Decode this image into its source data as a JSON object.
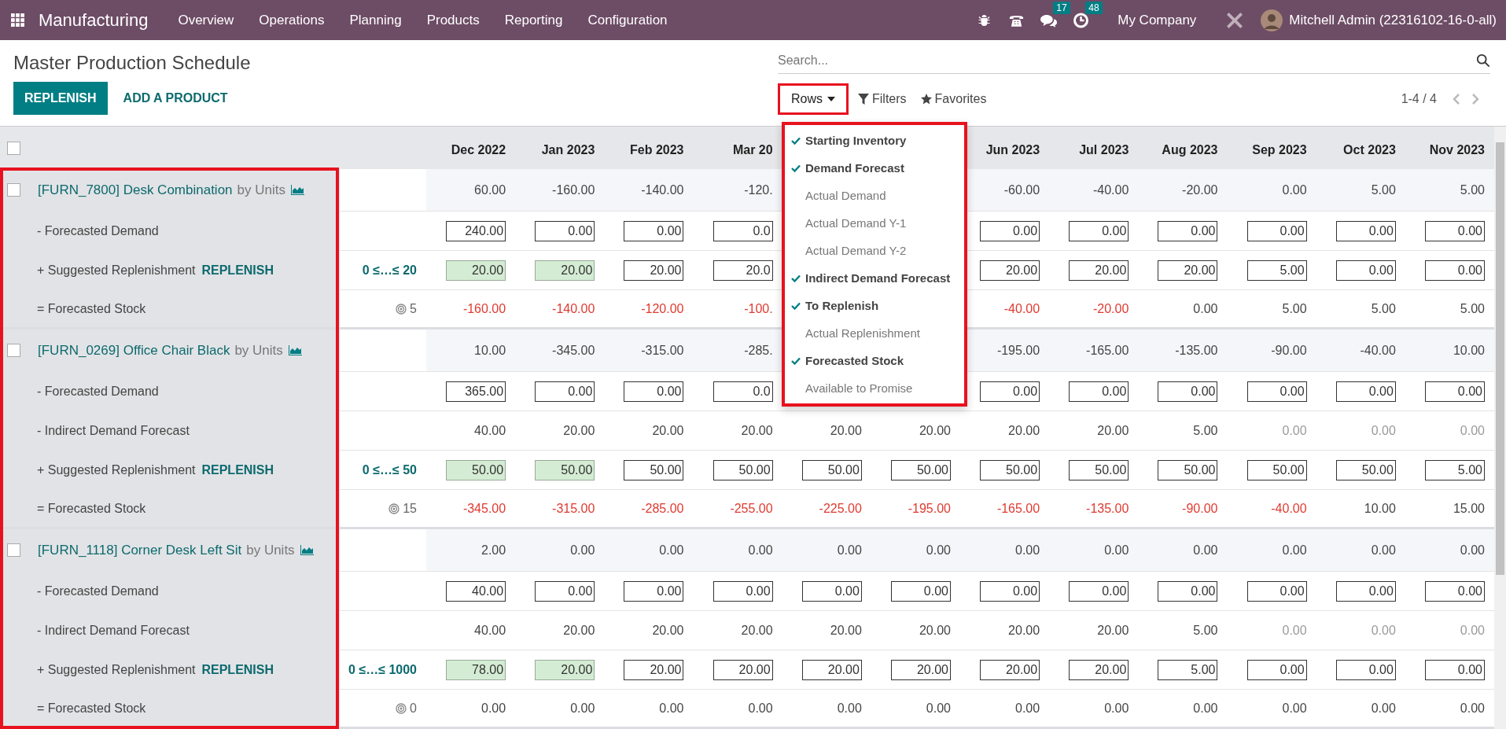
{
  "navbar": {
    "app_name": "Manufacturing",
    "menu": [
      "Overview",
      "Operations",
      "Planning",
      "Products",
      "Reporting",
      "Configuration"
    ],
    "messages_count": "17",
    "activities_count": "48",
    "company": "My Company",
    "user": "Mitchell Admin (22316102-16-0-all)"
  },
  "page": {
    "title": "Master Production Schedule",
    "buttons": [
      {
        "label": "REPLENISH",
        "kind": "primary"
      },
      {
        "label": "ADD A PRODUCT",
        "kind": "link"
      }
    ]
  },
  "search": {
    "placeholder": "Search..."
  },
  "toolbar": {
    "rows": "Rows",
    "filters": "Filters",
    "favorites": "Favorites",
    "pager": "1-4 / 4"
  },
  "rows_menu": {
    "items": [
      {
        "label": "Starting Inventory",
        "checked": true
      },
      {
        "label": "Demand Forecast",
        "checked": true
      },
      {
        "label": "Actual Demand",
        "checked": false
      },
      {
        "label": "Actual Demand Y-1",
        "checked": false
      },
      {
        "label": "Actual Demand Y-2",
        "checked": false
      },
      {
        "label": "Indirect Demand Forecast",
        "checked": true
      },
      {
        "label": "To Replenish",
        "checked": true
      },
      {
        "label": "Actual Replenishment",
        "checked": false
      },
      {
        "label": "Forecasted Stock",
        "checked": true
      },
      {
        "label": "Available to Promise",
        "checked": false
      }
    ]
  },
  "table": {
    "select_all_checked": false,
    "columns": [
      "Dec 2022",
      "Jan 2023",
      "Feb 2023",
      "Mar 20",
      null,
      null,
      "Jun 2023",
      "Jul 2023",
      "Aug 2023",
      "Sep 2023",
      "Oct 2023",
      "Nov 2023"
    ],
    "rows": [
      {
        "kind": "product",
        "checked": false,
        "product": "[FURN_7800] Desk Combination",
        "unit": "by Units",
        "cells": [
          {
            "text": "60.00",
            "kind": "plain"
          },
          {
            "text": "-160.00",
            "kind": "plain"
          },
          {
            "text": "-140.00",
            "kind": "plain"
          },
          {
            "text": "-120.",
            "kind": "plain"
          },
          null,
          null,
          {
            "text": "-60.00",
            "kind": "plain"
          },
          {
            "text": "-40.00",
            "kind": "plain"
          },
          {
            "text": "-20.00",
            "kind": "plain"
          },
          {
            "text": "0.00",
            "kind": "plain"
          },
          {
            "text": "5.00",
            "kind": "plain"
          },
          {
            "text": "5.00",
            "kind": "plain"
          }
        ]
      },
      {
        "kind": "demand",
        "label": "- Forecasted Demand",
        "cells": [
          {
            "text": "240.00",
            "kind": "plain"
          },
          {
            "text": "0.00",
            "kind": "plain"
          },
          {
            "text": "0.00",
            "kind": "plain"
          },
          {
            "text": "0.0",
            "kind": "plain"
          },
          null,
          null,
          {
            "text": "0.00",
            "kind": "plain"
          },
          {
            "text": "0.00",
            "kind": "plain"
          },
          {
            "text": "0.00",
            "kind": "plain"
          },
          {
            "text": "0.00",
            "kind": "plain"
          },
          {
            "text": "0.00",
            "kind": "plain"
          },
          {
            "text": "0.00",
            "kind": "plain"
          }
        ]
      },
      {
        "kind": "replenish",
        "label": "+ Suggested Replenishment",
        "action": "REPLENISH",
        "range": "0 ≤…≤ 20",
        "cells": [
          {
            "text": "20.00",
            "kind": "suggested"
          },
          {
            "text": "20.00",
            "kind": "suggested"
          },
          {
            "text": "20.00",
            "kind": "plain"
          },
          {
            "text": "20.0",
            "kind": "plain"
          },
          null,
          null,
          {
            "text": "20.00",
            "kind": "plain"
          },
          {
            "text": "20.00",
            "kind": "plain"
          },
          {
            "text": "20.00",
            "kind": "plain"
          },
          {
            "text": "5.00",
            "kind": "plain"
          },
          {
            "text": "0.00",
            "kind": "plain"
          },
          {
            "text": "0.00",
            "kind": "plain"
          }
        ]
      },
      {
        "kind": "stock",
        "label": "= Forecasted Stock",
        "safety": "5",
        "cells": [
          {
            "text": "-160.00",
            "kind": "negative"
          },
          {
            "text": "-140.00",
            "kind": "negative"
          },
          {
            "text": "-120.00",
            "kind": "negative"
          },
          {
            "text": "-100.",
            "kind": "negative"
          },
          null,
          null,
          {
            "text": "-40.00",
            "kind": "negative"
          },
          {
            "text": "-20.00",
            "kind": "negative"
          },
          {
            "text": "0.00",
            "kind": "plain"
          },
          {
            "text": "5.00",
            "kind": "plain"
          },
          {
            "text": "5.00",
            "kind": "plain"
          },
          {
            "text": "5.00",
            "kind": "plain"
          }
        ]
      },
      {
        "kind": "product",
        "checked": false,
        "product": "[FURN_0269] Office Chair Black",
        "unit": "by Units",
        "cells": [
          {
            "text": "10.00",
            "kind": "plain"
          },
          {
            "text": "-345.00",
            "kind": "plain"
          },
          {
            "text": "-315.00",
            "kind": "plain"
          },
          {
            "text": "-285.",
            "kind": "plain"
          },
          null,
          null,
          {
            "text": "-195.00",
            "kind": "plain"
          },
          {
            "text": "-165.00",
            "kind": "plain"
          },
          {
            "text": "-135.00",
            "kind": "plain"
          },
          {
            "text": "-90.00",
            "kind": "plain"
          },
          {
            "text": "-40.00",
            "kind": "plain"
          },
          {
            "text": "10.00",
            "kind": "plain"
          }
        ]
      },
      {
        "kind": "demand",
        "label": "- Forecasted Demand",
        "cells": [
          {
            "text": "365.00",
            "kind": "plain"
          },
          {
            "text": "0.00",
            "kind": "plain"
          },
          {
            "text": "0.00",
            "kind": "plain"
          },
          {
            "text": "0.0",
            "kind": "plain"
          },
          null,
          null,
          {
            "text": "0.00",
            "kind": "plain"
          },
          {
            "text": "0.00",
            "kind": "plain"
          },
          {
            "text": "0.00",
            "kind": "plain"
          },
          {
            "text": "0.00",
            "kind": "plain"
          },
          {
            "text": "0.00",
            "kind": "plain"
          },
          {
            "text": "0.00",
            "kind": "plain"
          }
        ]
      },
      {
        "kind": "indirect",
        "label": "- Indirect Demand Forecast",
        "cells": [
          {
            "text": "40.00",
            "kind": "plain"
          },
          {
            "text": "20.00",
            "kind": "plain"
          },
          {
            "text": "20.00",
            "kind": "plain"
          },
          {
            "text": "20.00",
            "kind": "plain"
          },
          {
            "text": "20.00",
            "kind": "plain"
          },
          {
            "text": "20.00",
            "kind": "plain"
          },
          {
            "text": "20.00",
            "kind": "plain"
          },
          {
            "text": "20.00",
            "kind": "plain"
          },
          {
            "text": "5.00",
            "kind": "plain"
          },
          {
            "text": "0.00",
            "kind": "muted"
          },
          {
            "text": "0.00",
            "kind": "muted"
          },
          {
            "text": "0.00",
            "kind": "muted"
          }
        ]
      },
      {
        "kind": "replenish",
        "label": "+ Suggested Replenishment",
        "action": "REPLENISH",
        "range": "0 ≤…≤ 50",
        "cells": [
          {
            "text": "50.00",
            "kind": "suggested"
          },
          {
            "text": "50.00",
            "kind": "suggested"
          },
          {
            "text": "50.00",
            "kind": "plain"
          },
          {
            "text": "50.00",
            "kind": "plain"
          },
          {
            "text": "50.00",
            "kind": "plain"
          },
          {
            "text": "50.00",
            "kind": "plain"
          },
          {
            "text": "50.00",
            "kind": "plain"
          },
          {
            "text": "50.00",
            "kind": "plain"
          },
          {
            "text": "50.00",
            "kind": "plain"
          },
          {
            "text": "50.00",
            "kind": "plain"
          },
          {
            "text": "50.00",
            "kind": "plain"
          },
          {
            "text": "5.00",
            "kind": "plain"
          }
        ]
      },
      {
        "kind": "stock",
        "label": "= Forecasted Stock",
        "safety": "15",
        "cells": [
          {
            "text": "-345.00",
            "kind": "negative"
          },
          {
            "text": "-315.00",
            "kind": "negative"
          },
          {
            "text": "-285.00",
            "kind": "negative"
          },
          {
            "text": "-255.00",
            "kind": "negative"
          },
          {
            "text": "-225.00",
            "kind": "negative"
          },
          {
            "text": "-195.00",
            "kind": "negative"
          },
          {
            "text": "-165.00",
            "kind": "negative"
          },
          {
            "text": "-135.00",
            "kind": "negative"
          },
          {
            "text": "-90.00",
            "kind": "negative"
          },
          {
            "text": "-40.00",
            "kind": "negative"
          },
          {
            "text": "10.00",
            "kind": "plain"
          },
          {
            "text": "15.00",
            "kind": "plain"
          }
        ]
      },
      {
        "kind": "product",
        "checked": false,
        "product": "[FURN_1118] Corner Desk Left Sit",
        "unit": "by Units",
        "cells": [
          {
            "text": "2.00",
            "kind": "plain"
          },
          {
            "text": "0.00",
            "kind": "plain"
          },
          {
            "text": "0.00",
            "kind": "plain"
          },
          {
            "text": "0.00",
            "kind": "plain"
          },
          {
            "text": "0.00",
            "kind": "plain"
          },
          {
            "text": "0.00",
            "kind": "plain"
          },
          {
            "text": "0.00",
            "kind": "plain"
          },
          {
            "text": "0.00",
            "kind": "plain"
          },
          {
            "text": "0.00",
            "kind": "plain"
          },
          {
            "text": "0.00",
            "kind": "plain"
          },
          {
            "text": "0.00",
            "kind": "plain"
          },
          {
            "text": "0.00",
            "kind": "plain"
          }
        ]
      },
      {
        "kind": "demand",
        "label": "- Forecasted Demand",
        "cells": [
          {
            "text": "40.00",
            "kind": "plain"
          },
          {
            "text": "0.00",
            "kind": "plain"
          },
          {
            "text": "0.00",
            "kind": "plain"
          },
          {
            "text": "0.00",
            "kind": "plain"
          },
          {
            "text": "0.00",
            "kind": "plain"
          },
          {
            "text": "0.00",
            "kind": "plain"
          },
          {
            "text": "0.00",
            "kind": "plain"
          },
          {
            "text": "0.00",
            "kind": "plain"
          },
          {
            "text": "0.00",
            "kind": "plain"
          },
          {
            "text": "0.00",
            "kind": "plain"
          },
          {
            "text": "0.00",
            "kind": "plain"
          },
          {
            "text": "0.00",
            "kind": "plain"
          }
        ]
      },
      {
        "kind": "indirect",
        "label": "- Indirect Demand Forecast",
        "cells": [
          {
            "text": "40.00",
            "kind": "plain"
          },
          {
            "text": "20.00",
            "kind": "plain"
          },
          {
            "text": "20.00",
            "kind": "plain"
          },
          {
            "text": "20.00",
            "kind": "plain"
          },
          {
            "text": "20.00",
            "kind": "plain"
          },
          {
            "text": "20.00",
            "kind": "plain"
          },
          {
            "text": "20.00",
            "kind": "plain"
          },
          {
            "text": "20.00",
            "kind": "plain"
          },
          {
            "text": "5.00",
            "kind": "plain"
          },
          {
            "text": "0.00",
            "kind": "muted"
          },
          {
            "text": "0.00",
            "kind": "muted"
          },
          {
            "text": "0.00",
            "kind": "muted"
          }
        ]
      },
      {
        "kind": "replenish",
        "label": "+ Suggested Replenishment",
        "action": "REPLENISH",
        "range": "0 ≤…≤ 1000",
        "cells": [
          {
            "text": "78.00",
            "kind": "suggested"
          },
          {
            "text": "20.00",
            "kind": "suggested"
          },
          {
            "text": "20.00",
            "kind": "plain"
          },
          {
            "text": "20.00",
            "kind": "plain"
          },
          {
            "text": "20.00",
            "kind": "plain"
          },
          {
            "text": "20.00",
            "kind": "plain"
          },
          {
            "text": "20.00",
            "kind": "plain"
          },
          {
            "text": "20.00",
            "kind": "plain"
          },
          {
            "text": "5.00",
            "kind": "plain"
          },
          {
            "text": "0.00",
            "kind": "plain"
          },
          {
            "text": "0.00",
            "kind": "plain"
          },
          {
            "text": "0.00",
            "kind": "plain"
          }
        ]
      },
      {
        "kind": "stock",
        "label": "= Forecasted Stock",
        "safety": "0",
        "cells": [
          {
            "text": "0.00",
            "kind": "plain"
          },
          {
            "text": "0.00",
            "kind": "plain"
          },
          {
            "text": "0.00",
            "kind": "plain"
          },
          {
            "text": "0.00",
            "kind": "plain"
          },
          {
            "text": "0.00",
            "kind": "plain"
          },
          {
            "text": "0.00",
            "kind": "plain"
          },
          {
            "text": "0.00",
            "kind": "plain"
          },
          {
            "text": "0.00",
            "kind": "plain"
          },
          {
            "text": "0.00",
            "kind": "plain"
          },
          {
            "text": "0.00",
            "kind": "plain"
          },
          {
            "text": "0.00",
            "kind": "plain"
          },
          {
            "text": "0.00",
            "kind": "plain"
          }
        ]
      }
    ]
  }
}
